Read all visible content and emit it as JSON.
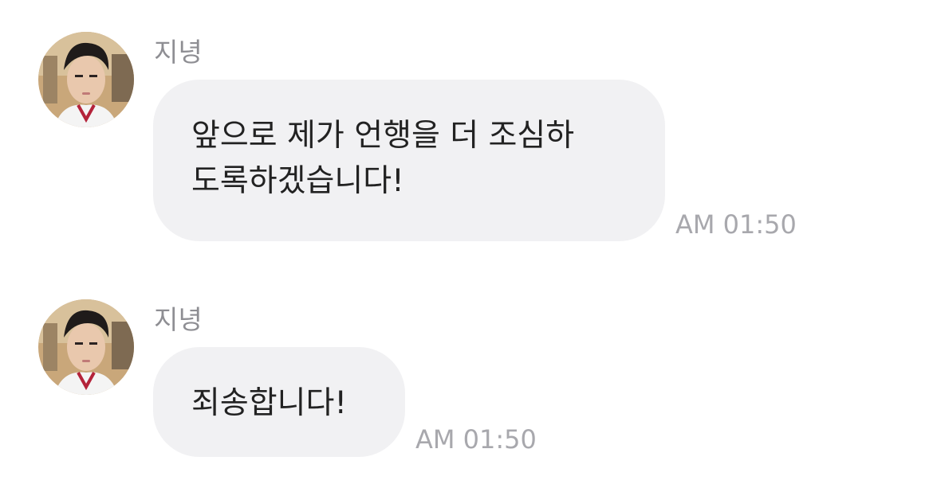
{
  "messages": [
    {
      "sender": "지녕",
      "lines": [
        "앞으로 제가 언행을 더 조심하",
        "도록하겠습니다!"
      ],
      "time": "AM 01:50",
      "avatar_icon": "profile-photo-icon"
    },
    {
      "sender": "지녕",
      "lines": [
        "죄송합니다!"
      ],
      "time": "AM 01:50",
      "avatar_icon": "profile-photo-icon"
    }
  ],
  "colors": {
    "bubble_bg": "#f1f1f3",
    "sender_text": "#8e8e93",
    "message_text": "#222222",
    "timestamp_text": "#a8a8ad"
  }
}
